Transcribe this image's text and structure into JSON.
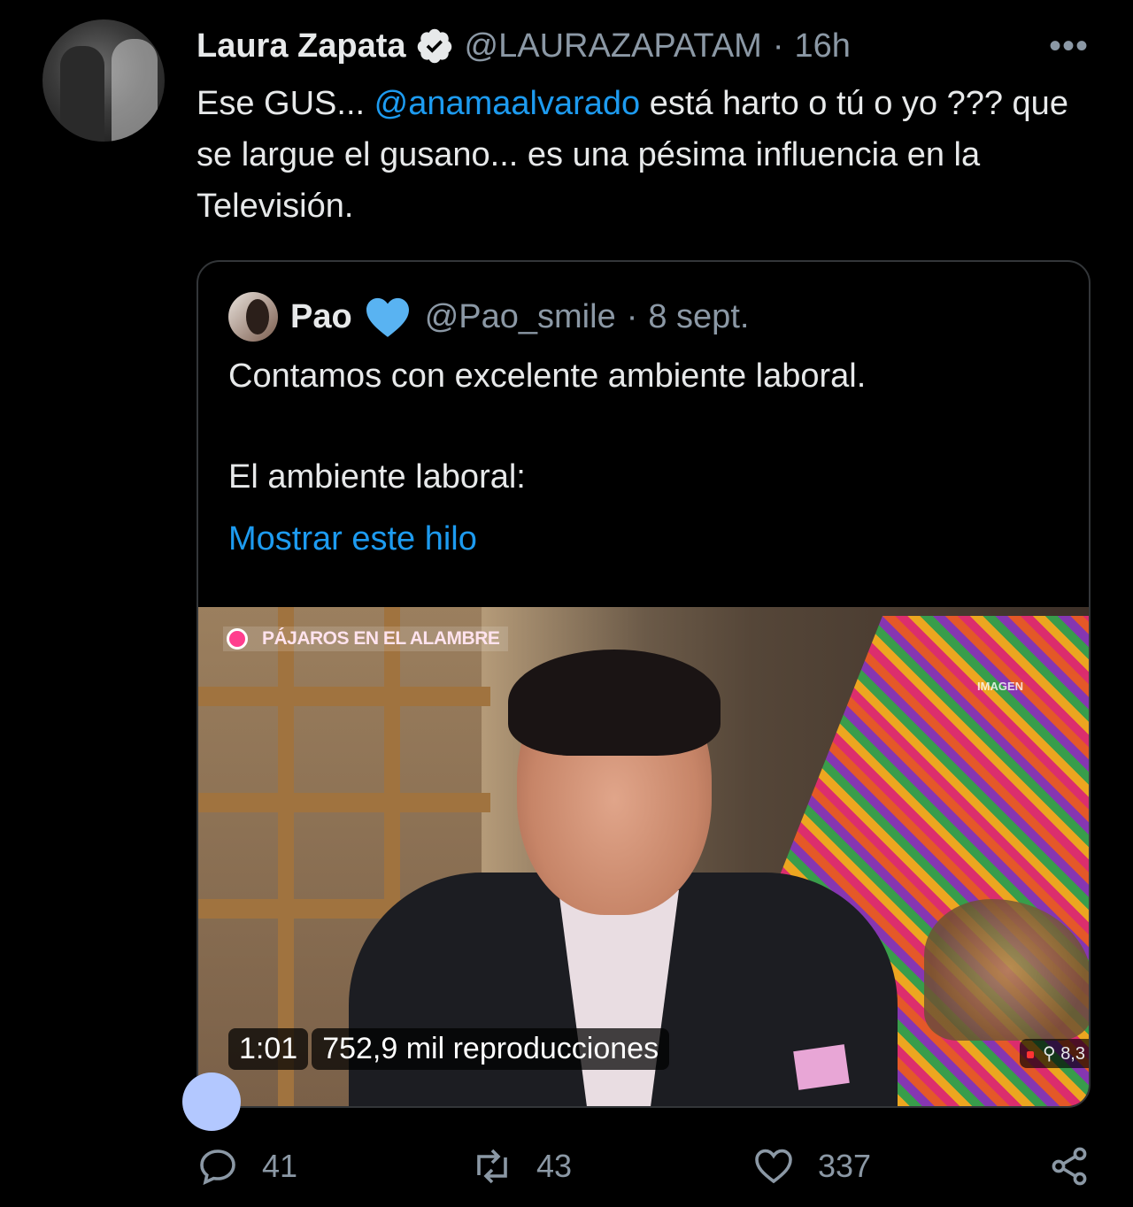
{
  "tweet": {
    "author_name": "Laura Zapata",
    "handle": "@LAURAZAPATAM",
    "separator": "·",
    "time": "16h",
    "more_label": "•••",
    "text_before": "Ese GUS... ",
    "mention": "@anamaalvarado",
    "text_after": " está harto o tú o yo ??? que se largue el gusano... es una pésima influencia en la Televisión."
  },
  "quote": {
    "author_name": "Pao",
    "handle": "@Pao_smile",
    "separator": "·",
    "date": "8 sept.",
    "line1": "Contamos con excelente ambiente laboral.",
    "line2": "El ambiente laboral:",
    "show_thread": "Mostrar este hilo",
    "video": {
      "channel_tag": "PÁJAROS EN EL ALAMBRE",
      "watermark": "IMAGEN",
      "duration": "1:01",
      "views": "752,9 mil reproducciones",
      "live_viewers": "8,3"
    }
  },
  "actions": {
    "replies": "41",
    "retweets": "43",
    "likes": "337"
  },
  "colors": {
    "background": "#000000",
    "text": "#e7e9ea",
    "secondary": "#8b98a5",
    "link": "#1d9bf0",
    "border": "#333639"
  },
  "icons": [
    "verified-badge-icon",
    "blue-heart-icon",
    "reply-icon",
    "retweet-icon",
    "like-icon",
    "share-icon",
    "more-icon"
  ]
}
